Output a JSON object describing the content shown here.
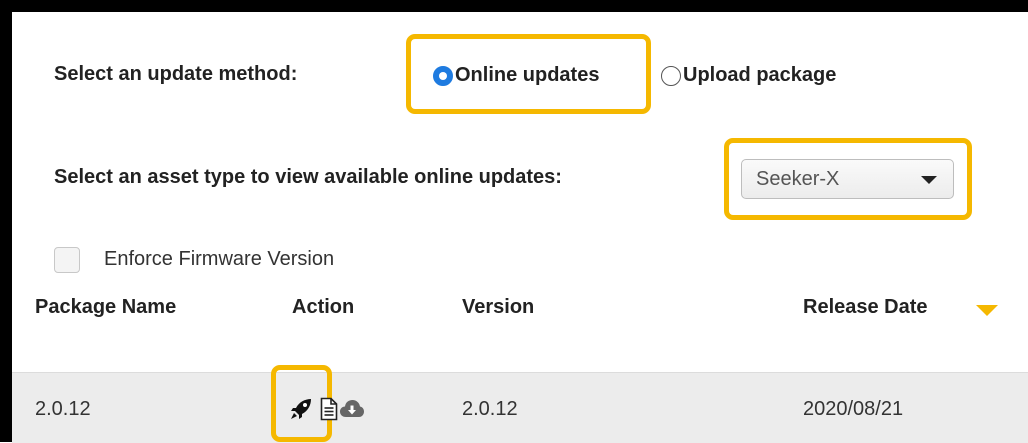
{
  "update_method": {
    "label": "Select an update method:",
    "options": [
      {
        "label": "Online updates",
        "selected": true
      },
      {
        "label": "Upload package",
        "selected": false
      }
    ]
  },
  "asset_type": {
    "label": "Select an asset type to view available online updates:",
    "selected": "Seeker-X"
  },
  "enforce_firmware": {
    "label": "Enforce Firmware Version",
    "checked": false
  },
  "table": {
    "columns": [
      "Package Name",
      "Action",
      "Version",
      "Release Date"
    ],
    "sort_column": "Release Date",
    "rows": [
      {
        "package_name": "2.0.12",
        "actions": [
          "rocket-icon",
          "document-icon",
          "cloud-download-icon"
        ],
        "version": "2.0.12",
        "release_date": "2020/08/21"
      }
    ]
  },
  "colors": {
    "highlight": "#f5b800",
    "radio_selected": "#1e7be0",
    "row_background": "#ececec"
  }
}
